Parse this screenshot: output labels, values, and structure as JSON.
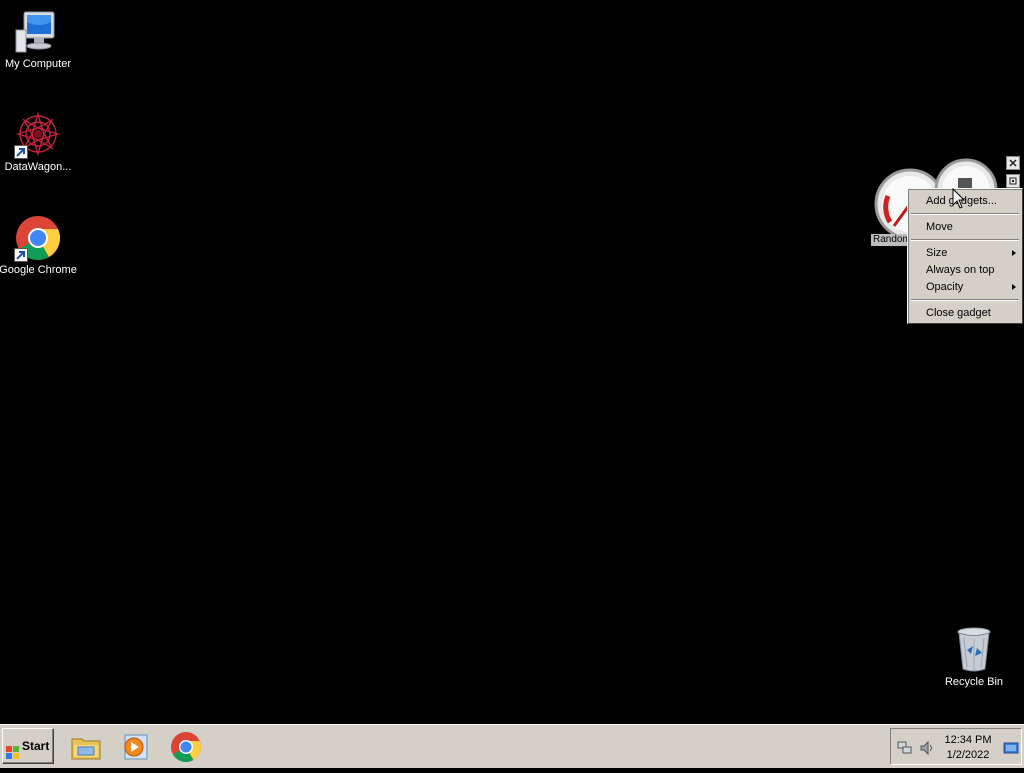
{
  "desktop": {
    "icons": {
      "my_computer": {
        "label": "My Computer",
        "icon": "computer-icon"
      },
      "datawagon": {
        "label": "DataWagon...",
        "icon": "datawagon-icon"
      },
      "chrome": {
        "label": "Google Chrome",
        "icon": "chrome-icon"
      },
      "recycle_bin": {
        "label": "Recycle Bin",
        "icon": "recycle-bin-icon"
      }
    }
  },
  "gadget": {
    "label": "Random",
    "icon": "gauge-meter-icon"
  },
  "context_menu": {
    "items": [
      {
        "label": "Add gadgets...",
        "has_submenu": false
      },
      {
        "label": "Move",
        "has_submenu": false
      },
      {
        "label": "Size",
        "has_submenu": true
      },
      {
        "label": "Always on top",
        "has_submenu": false
      },
      {
        "label": "Opacity",
        "has_submenu": true
      },
      {
        "label": "Close gadget",
        "has_submenu": false
      }
    ]
  },
  "taskbar": {
    "start_label": "Start",
    "quick_launch": [
      "file-explorer-icon",
      "media-player-icon",
      "chrome-icon"
    ],
    "tray": {
      "icons": [
        "network-icon",
        "volume-icon",
        "show-desktop-icon"
      ],
      "time": "12:34 PM",
      "date": "1/2/2022"
    }
  },
  "colors": {
    "desktop_bg": "#000000",
    "taskbar_bg": "#d4d0c8",
    "menu_bg": "#d4d0c8"
  }
}
